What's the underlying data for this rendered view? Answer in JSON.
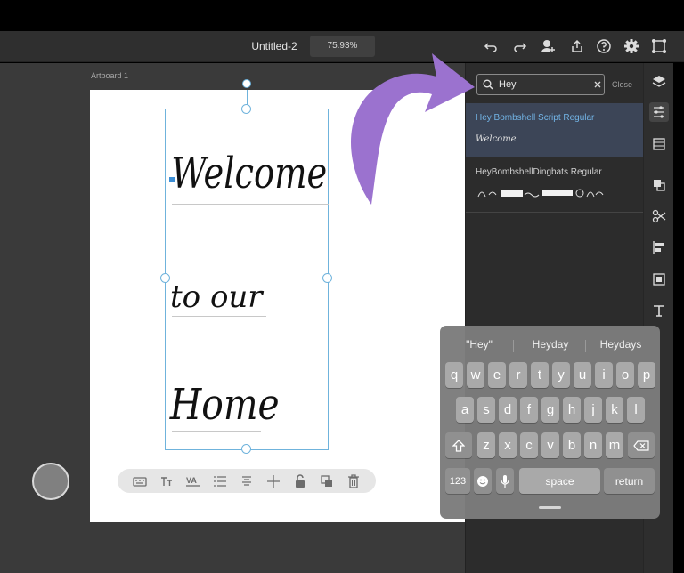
{
  "app": {
    "doc_title": "Untitled-2",
    "zoom_level": "75.93%",
    "artboard_label": "Artboard 1"
  },
  "artboard_text": {
    "line1": "Welcome",
    "line2": "to our",
    "line3": "Home"
  },
  "font_panel": {
    "search_value": "Hey",
    "close_label": "Close",
    "results": [
      {
        "name": "Hey Bombshell Script Regular",
        "sample": "Welcome"
      },
      {
        "name": "HeyBombshellDingbats Regular"
      }
    ]
  },
  "keyboard": {
    "suggestions": [
      "\"Hey\"",
      "Heyday",
      "Heydays"
    ],
    "row1": [
      "q",
      "w",
      "e",
      "r",
      "t",
      "y",
      "u",
      "i",
      "o",
      "p"
    ],
    "row2": [
      "a",
      "s",
      "d",
      "f",
      "g",
      "h",
      "j",
      "k",
      "l"
    ],
    "row3": [
      "z",
      "x",
      "c",
      "v",
      "b",
      "n",
      "m"
    ],
    "numbers_label": "123",
    "space_label": "space",
    "return_label": "return"
  },
  "colors": {
    "accent": "#6fb3dc",
    "selected_row": "#3c4557",
    "arrow": "#9b72cf",
    "fill_swatch": "#808080"
  },
  "icons": {
    "topbar": [
      "undo-icon",
      "redo-icon",
      "add-user-icon",
      "share-icon",
      "help-icon",
      "settings-icon",
      "plugins-icon"
    ],
    "rail": [
      "layers-icon",
      "properties-icon",
      "assets-icon",
      "arrange-icon",
      "cut-icon",
      "align-icon",
      "scale-icon",
      "text-icon"
    ],
    "context": [
      "keyboard-icon",
      "text-size-icon",
      "character-spacing-icon",
      "list-icon",
      "text-align-icon",
      "move-icon",
      "unlock-icon",
      "duplicate-icon",
      "delete-icon"
    ]
  }
}
